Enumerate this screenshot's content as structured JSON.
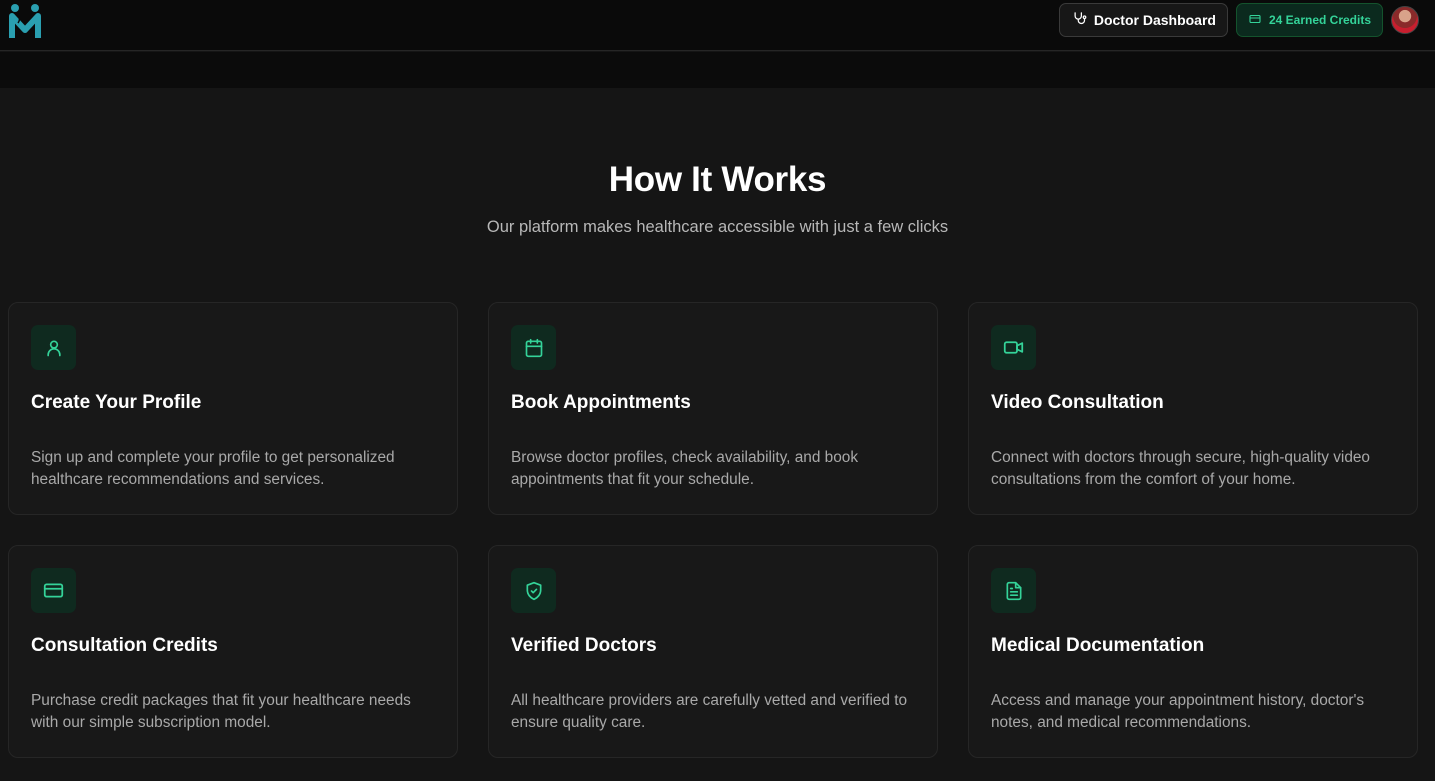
{
  "header": {
    "logo_alt": "M",
    "dashboard_button": "Doctor Dashboard",
    "credits_badge": "24 Earned Credits"
  },
  "section": {
    "title": "How It Works",
    "subtitle": "Our platform makes healthcare accessible with just a few clicks"
  },
  "cards": [
    {
      "icon": "user-icon",
      "title": "Create Your Profile",
      "description": "Sign up and complete your profile to get personalized healthcare recommendations and services."
    },
    {
      "icon": "calendar-icon",
      "title": "Book Appointments",
      "description": "Browse doctor profiles, check availability, and book appointments that fit your schedule."
    },
    {
      "icon": "video-icon",
      "title": "Video Consultation",
      "description": "Connect with doctors through secure, high-quality video consultations from the comfort of your home."
    },
    {
      "icon": "credit-card-icon",
      "title": "Consultation Credits",
      "description": "Purchase credit packages that fit your healthcare needs with our simple subscription model."
    },
    {
      "icon": "shield-check-icon",
      "title": "Verified Doctors",
      "description": "All healthcare providers are carefully vetted and verified to ensure quality care."
    },
    {
      "icon": "file-text-icon",
      "title": "Medical Documentation",
      "description": "Access and manage your appointment history, doctor's notes, and medical recommendations."
    }
  ],
  "colors": {
    "accent": "#34d399",
    "background": "#151515",
    "card": "#181818"
  }
}
